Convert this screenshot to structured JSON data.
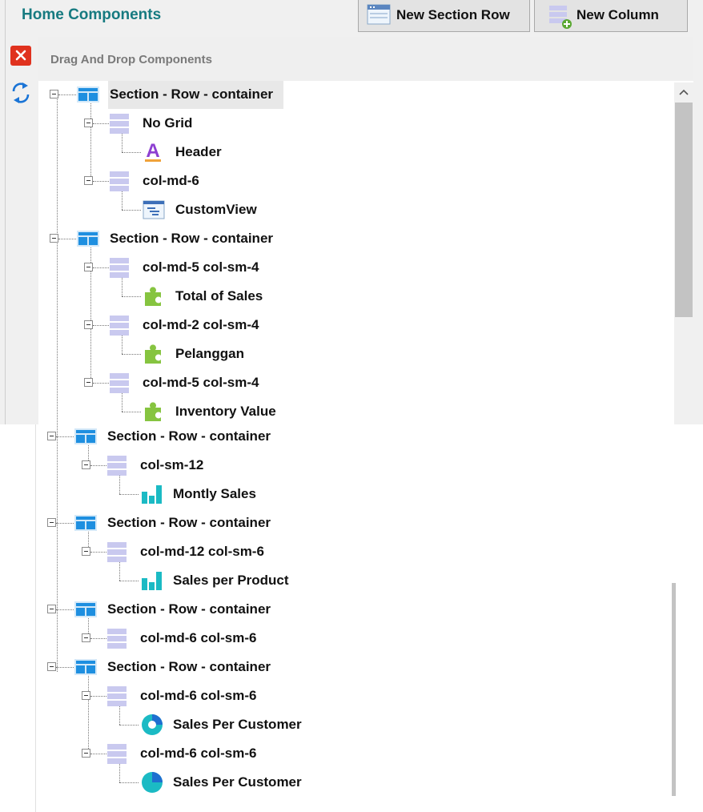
{
  "panel": {
    "title": "Home Components",
    "subheader": "Drag And Drop Components"
  },
  "toolbar": {
    "new_section_row": "New Section Row",
    "new_column": "New Column"
  },
  "side_actions": {
    "close_icon": "close-icon",
    "refresh_icon": "refresh-icon"
  },
  "colors": {
    "title": "#167a80",
    "close": "#e0321e",
    "refresh": "#1a74d6",
    "section_icon": "#1e8fe0",
    "column_icon": "#c9c9ef",
    "header_icon": "#8d3fd1",
    "component_icon": "#86c440",
    "chart_icon": "#1bbac4"
  },
  "tree": {
    "nodes": [
      {
        "label": "Section - Row - container",
        "icon": "section-icon",
        "level": 0,
        "selected": true
      },
      {
        "label": "No Grid",
        "icon": "column-icon",
        "level": 1
      },
      {
        "label": "Header",
        "icon": "text-header-icon",
        "level": 2
      },
      {
        "label": "col-md-6",
        "icon": "column-icon",
        "level": 1
      },
      {
        "label": "CustomView",
        "icon": "custom-view-icon",
        "level": 2
      },
      {
        "label": "Section - Row - container",
        "icon": "section-icon",
        "level": 0
      },
      {
        "label": "col-md-5 col-sm-4",
        "icon": "column-icon",
        "level": 1
      },
      {
        "label": "Total of Sales",
        "icon": "puzzle-icon",
        "level": 2
      },
      {
        "label": "col-md-2 col-sm-4",
        "icon": "column-icon",
        "level": 1
      },
      {
        "label": "Pelanggan",
        "icon": "puzzle-icon",
        "level": 2
      },
      {
        "label": "col-md-5 col-sm-4",
        "icon": "column-icon",
        "level": 1
      },
      {
        "label": "Inventory Value",
        "icon": "puzzle-icon",
        "level": 2
      },
      {
        "label": "Section - Row - container",
        "icon": "section-icon",
        "level": 0
      },
      {
        "label": "col-sm-12",
        "icon": "column-icon",
        "level": 1
      },
      {
        "label": "Montly Sales",
        "icon": "bar-chart-icon",
        "level": 2
      },
      {
        "label": "Section - Row - container",
        "icon": "section-icon",
        "level": 0
      },
      {
        "label": "col-md-12 col-sm-6",
        "icon": "column-icon",
        "level": 1
      },
      {
        "label": "Sales per Product",
        "icon": "bar-chart-icon",
        "level": 2
      },
      {
        "label": "Section - Row - container",
        "icon": "section-icon",
        "level": 0
      },
      {
        "label": "col-md-6 col-sm-6",
        "icon": "column-icon",
        "level": 1
      },
      {
        "label": "Section - Row - container",
        "icon": "section-icon",
        "level": 0
      },
      {
        "label": "col-md-6 col-sm-6",
        "icon": "column-icon",
        "level": 1
      },
      {
        "label": "Sales Per Customer",
        "icon": "donut-chart-icon",
        "level": 2
      },
      {
        "label": "col-md-6 col-sm-6",
        "icon": "column-icon",
        "level": 1
      },
      {
        "label": "Sales Per Customer",
        "icon": "pie-chart-icon",
        "level": 2
      }
    ]
  }
}
